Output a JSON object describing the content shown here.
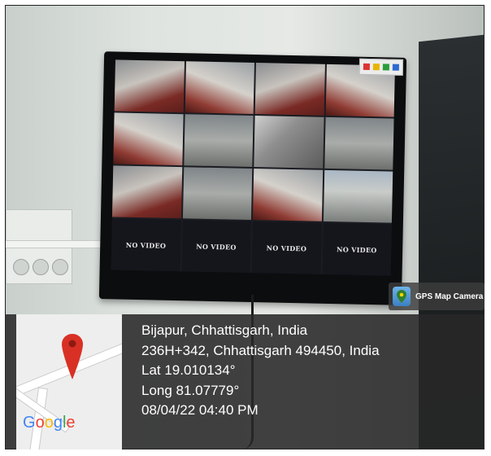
{
  "screen": {
    "tiles": [
      {
        "kind": "cam",
        "tone": "cam-a"
      },
      {
        "kind": "cam",
        "tone": "cam-b"
      },
      {
        "kind": "cam",
        "tone": "cam-a"
      },
      {
        "kind": "cam",
        "tone": "cam-b"
      },
      {
        "kind": "cam",
        "tone": "cam-b"
      },
      {
        "kind": "cam",
        "tone": "cam-c"
      },
      {
        "kind": "cam",
        "tone": "cam-d"
      },
      {
        "kind": "cam",
        "tone": "cam-c"
      },
      {
        "kind": "cam",
        "tone": "cam-a"
      },
      {
        "kind": "cam",
        "tone": "cam-c"
      },
      {
        "kind": "cam",
        "tone": "cam-b"
      },
      {
        "kind": "cam",
        "tone": "cam-e"
      },
      {
        "kind": "novideo",
        "text": "NO VIDEO"
      },
      {
        "kind": "novideo",
        "text": "NO VIDEO"
      },
      {
        "kind": "novideo",
        "text": "NO VIDEO"
      },
      {
        "kind": "novideo",
        "text": "NO VIDEO"
      }
    ]
  },
  "badge": {
    "label": "GPS Map Camera",
    "icon": "map-pin-icon"
  },
  "map": {
    "brand": "Google",
    "pin_color": "#d93025"
  },
  "info": {
    "place": "Bijapur, Chhattisgarh, India",
    "address": "236H+342, Chhattisgarh 494450, India",
    "lat": "Lat 19.010134°",
    "long": "Long 81.07779°",
    "datetime": "08/04/22 04:40 PM"
  }
}
